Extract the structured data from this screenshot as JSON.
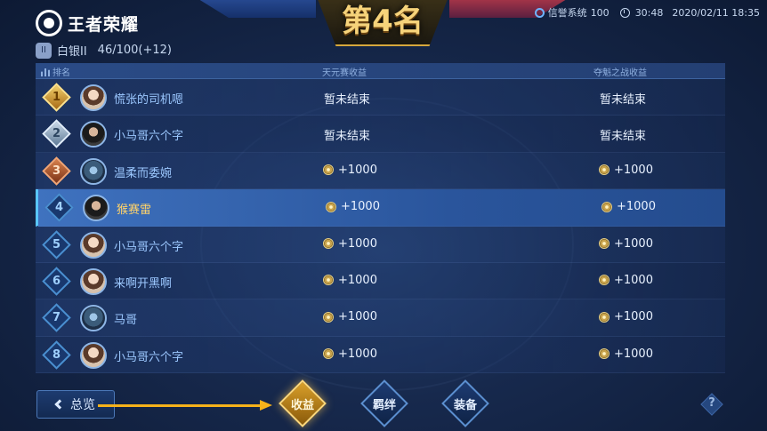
{
  "header": {
    "logo_text": "王者荣耀",
    "rank_badge": "II",
    "rank_name": "白银II",
    "rank_points": "46/100(+12)",
    "title": "第4名",
    "credit_label": "信誉系统",
    "credit_value": "100",
    "clock_time": "30:48",
    "date": "2020/02/11 18:35"
  },
  "columns": {
    "rank": "排名",
    "col1": "天元赛收益",
    "col2": "夺魁之战收益"
  },
  "rows": [
    {
      "rank": "1",
      "medal": "gold",
      "name": "慌张的司机嗯",
      "v1": "暂未结束",
      "v2": "暂未结束",
      "coin": false,
      "current": false
    },
    {
      "rank": "2",
      "medal": "silver",
      "name": "小马哥六个字",
      "v1": "暂未结束",
      "v2": "暂未结束",
      "coin": false,
      "current": false
    },
    {
      "rank": "3",
      "medal": "bronze",
      "name": "温柔而委婉",
      "v1": "+1000",
      "v2": "+1000",
      "coin": true,
      "current": false
    },
    {
      "rank": "4",
      "medal": "blue",
      "name": "猴赛雷",
      "v1": "+1000",
      "v2": "+1000",
      "coin": true,
      "current": true
    },
    {
      "rank": "5",
      "medal": "blue",
      "name": "小马哥六个字",
      "v1": "+1000",
      "v2": "+1000",
      "coin": true,
      "current": false
    },
    {
      "rank": "6",
      "medal": "blue",
      "name": "来啊开黑啊",
      "v1": "+1000",
      "v2": "+1000",
      "coin": true,
      "current": false
    },
    {
      "rank": "7",
      "medal": "blue",
      "name": "马哥",
      "v1": "+1000",
      "v2": "+1000",
      "coin": true,
      "current": false
    },
    {
      "rank": "8",
      "medal": "blue",
      "name": "小马哥六个字",
      "v1": "+1000",
      "v2": "+1000",
      "coin": true,
      "current": false
    }
  ],
  "footer": {
    "back_label": "总览",
    "tab_earnings": "收益",
    "tab_bond": "羁绊",
    "tab_equipment": "装备",
    "help": "?"
  },
  "colors": {
    "accent_gold": "#f6b21a",
    "highlight_row": "#3f72bf",
    "name_blue": "#9cc8ff"
  }
}
